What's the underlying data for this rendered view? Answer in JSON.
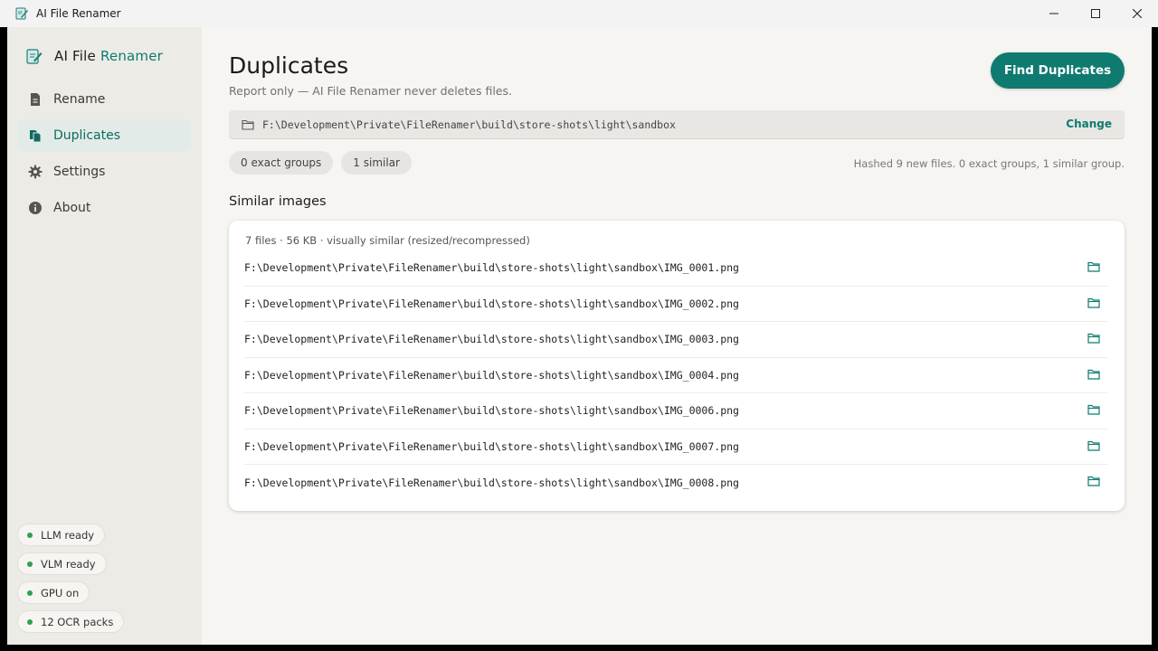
{
  "window": {
    "title": "AI File Renamer"
  },
  "brand": {
    "name_part1": "AI File",
    "name_part2": "Renamer"
  },
  "nav": {
    "items": [
      {
        "label": "Rename",
        "icon": "document-icon"
      },
      {
        "label": "Duplicates",
        "icon": "copy-icon",
        "active": true
      },
      {
        "label": "Settings",
        "icon": "gear-icon"
      },
      {
        "label": "About",
        "icon": "info-icon"
      }
    ]
  },
  "status": {
    "items": [
      "LLM ready",
      "VLM ready",
      "GPU on",
      "12 OCR packs"
    ],
    "dot_color": "#2f9e57"
  },
  "page": {
    "title": "Duplicates",
    "subtitle": "Report only — AI File Renamer never deletes files.",
    "find_button": "Find Duplicates",
    "folder_path": "F:\\Development\\Private\\FileRenamer\\build\\store-shots\\light\\sandbox",
    "change_label": "Change",
    "chip_exact": "0 exact groups",
    "chip_similar": "1 similar",
    "summary": "Hashed 9 new files. 0 exact groups, 1 similar group."
  },
  "similar": {
    "section_title": "Similar images",
    "group_meta": "7 files · 56 KB · visually similar (resized/recompressed)",
    "files": [
      "F:\\Development\\Private\\FileRenamer\\build\\store-shots\\light\\sandbox\\IMG_0001.png",
      "F:\\Development\\Private\\FileRenamer\\build\\store-shots\\light\\sandbox\\IMG_0002.png",
      "F:\\Development\\Private\\FileRenamer\\build\\store-shots\\light\\sandbox\\IMG_0003.png",
      "F:\\Development\\Private\\FileRenamer\\build\\store-shots\\light\\sandbox\\IMG_0004.png",
      "F:\\Development\\Private\\FileRenamer\\build\\store-shots\\light\\sandbox\\IMG_0006.png",
      "F:\\Development\\Private\\FileRenamer\\build\\store-shots\\light\\sandbox\\IMG_0007.png",
      "F:\\Development\\Private\\FileRenamer\\build\\store-shots\\light\\sandbox\\IMG_0008.png"
    ]
  },
  "colors": {
    "accent": "#0f7a70",
    "sidebar_bg": "#ecebe6",
    "content_bg": "#f6f5f2"
  }
}
